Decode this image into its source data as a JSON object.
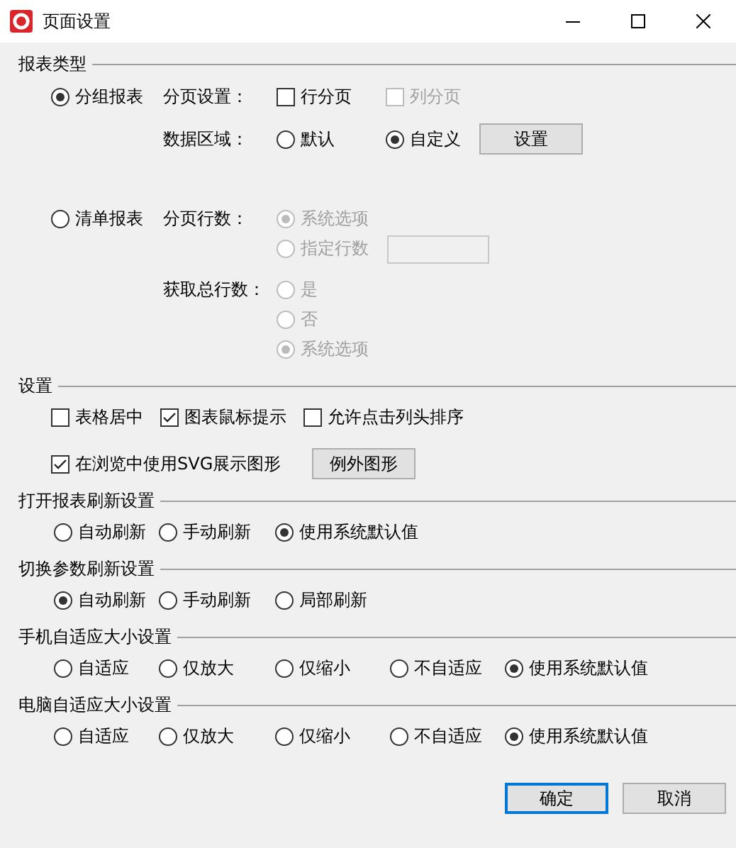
{
  "window": {
    "title": "页面设置"
  },
  "report_type": {
    "title": "报表类型",
    "options": [
      {
        "label": "分组报表",
        "selected": true,
        "groups": [
          {
            "label": "分页设置：",
            "lines": [
              [
                {
                  "kind": "checkbox",
                  "label": "行分页",
                  "checked": false,
                  "disabled": false
                },
                {
                  "kind": "checkbox",
                  "label": "列分页",
                  "checked": false,
                  "disabled": true
                }
              ]
            ]
          },
          {
            "label": "数据区域：",
            "lines": [
              [
                {
                  "kind": "radio",
                  "label": "默认",
                  "selected": false,
                  "disabled": false
                },
                {
                  "kind": "radio",
                  "label": "自定义",
                  "selected": true,
                  "disabled": false
                },
                {
                  "kind": "button",
                  "label": "设置"
                }
              ]
            ]
          }
        ]
      },
      {
        "label": "清单报表",
        "selected": false,
        "groups": [
          {
            "label": "分页行数：",
            "lines": [
              [
                {
                  "kind": "radio",
                  "label": "系统选项",
                  "selected": true,
                  "disabled": true
                }
              ],
              [
                {
                  "kind": "radio",
                  "label": "指定行数",
                  "selected": false,
                  "disabled": true
                },
                {
                  "kind": "field",
                  "disabled": true
                }
              ]
            ]
          },
          {
            "label": "获取总行数：",
            "lines": [
              [
                {
                  "kind": "radio",
                  "label": "是",
                  "selected": false,
                  "disabled": true
                }
              ],
              [
                {
                  "kind": "radio",
                  "label": "否",
                  "selected": false,
                  "disabled": true
                }
              ],
              [
                {
                  "kind": "radio",
                  "label": "系统选项",
                  "selected": true,
                  "disabled": true
                }
              ]
            ]
          }
        ]
      }
    ]
  },
  "sections": [
    {
      "title": "设置",
      "lines": [
        [
          {
            "kind": "checkbox",
            "label": "表格居中",
            "checked": false,
            "disabled": false
          },
          {
            "kind": "checkbox",
            "label": "图表鼠标提示",
            "checked": true,
            "disabled": false
          },
          {
            "kind": "checkbox",
            "label": "允许点击列头排序",
            "checked": false,
            "disabled": false
          }
        ],
        [
          {
            "kind": "checkbox",
            "label": "在浏览中使用SVG展示图形",
            "checked": true,
            "disabled": false
          },
          {
            "kind": "button",
            "label": "例外图形"
          }
        ]
      ]
    },
    {
      "title": "打开报表刷新设置",
      "lines": [
        [
          {
            "kind": "radio",
            "label": "自动刷新",
            "selected": false,
            "disabled": false
          },
          {
            "kind": "radio",
            "label": "手动刷新",
            "selected": false,
            "disabled": false
          },
          {
            "kind": "radio",
            "label": "使用系统默认值",
            "selected": true,
            "disabled": false
          }
        ]
      ]
    },
    {
      "title": "切换参数刷新设置",
      "lines": [
        [
          {
            "kind": "radio",
            "label": "自动刷新",
            "selected": true,
            "disabled": false
          },
          {
            "kind": "radio",
            "label": "手动刷新",
            "selected": false,
            "disabled": false
          },
          {
            "kind": "radio",
            "label": "局部刷新",
            "selected": false,
            "disabled": false
          }
        ]
      ]
    },
    {
      "title": "手机自适应大小设置",
      "lines": [
        [
          {
            "kind": "radio",
            "label": "自适应",
            "selected": false,
            "disabled": false
          },
          {
            "kind": "radio",
            "label": "仅放大",
            "selected": false,
            "disabled": false
          },
          {
            "kind": "radio",
            "label": "仅缩小",
            "selected": false,
            "disabled": false
          },
          {
            "kind": "radio",
            "label": "不自适应",
            "selected": false,
            "disabled": false
          },
          {
            "kind": "radio",
            "label": "使用系统默认值",
            "selected": true,
            "disabled": false
          }
        ]
      ]
    },
    {
      "title": "电脑自适应大小设置",
      "lines": [
        [
          {
            "kind": "radio",
            "label": "自适应",
            "selected": false,
            "disabled": false
          },
          {
            "kind": "radio",
            "label": "仅放大",
            "selected": false,
            "disabled": false
          },
          {
            "kind": "radio",
            "label": "仅缩小",
            "selected": false,
            "disabled": false
          },
          {
            "kind": "radio",
            "label": "不自适应",
            "selected": false,
            "disabled": false
          },
          {
            "kind": "radio",
            "label": "使用系统默认值",
            "selected": true,
            "disabled": false
          }
        ]
      ]
    }
  ],
  "buttons": [
    {
      "label": "确定",
      "default": true
    },
    {
      "label": "取消",
      "default": false
    }
  ]
}
